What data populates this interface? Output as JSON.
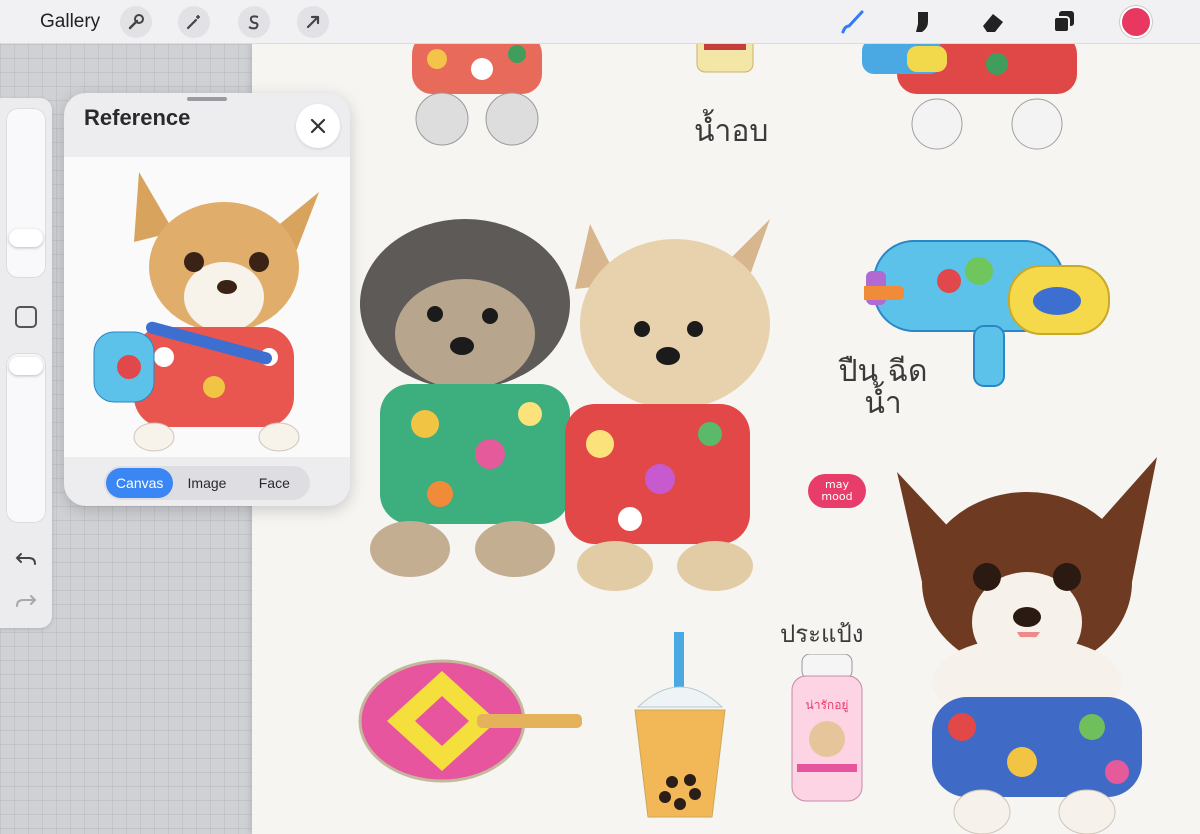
{
  "toolbar": {
    "gallery_label": "Gallery",
    "left_tools": [
      "wrench-icon",
      "magic-wand-icon",
      "selection-s-icon",
      "arrow-cursor-icon"
    ],
    "right_tools": [
      "brush-icon",
      "smudge-icon",
      "eraser-icon",
      "layers-icon"
    ],
    "active_tool": "brush",
    "current_color": "#e8385f",
    "accent": "#2f7cf6"
  },
  "sidebar": {
    "brush_size_level": 0.3,
    "opacity_level": 0.05,
    "undo_icon": "undo-icon",
    "redo_icon": "redo-icon"
  },
  "reference": {
    "title": "Reference",
    "tabs": [
      "Canvas",
      "Image",
      "Face"
    ],
    "active_tab": "Canvas"
  },
  "canvas": {
    "labels": {
      "perfume": "น้ำอบ",
      "water_gun": "ปืน ฉีด น้ำ",
      "powder": "ประแป้ง",
      "powder_brand": "น่ารักอยู่",
      "logo": "may mood"
    }
  }
}
